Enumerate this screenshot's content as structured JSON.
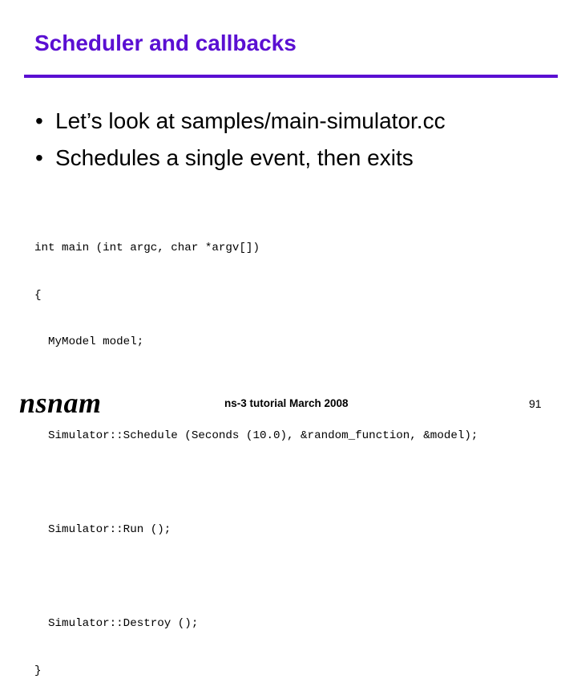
{
  "slide": {
    "title": "Scheduler and callbacks",
    "accent_color": "#5a0fd2",
    "bullets": [
      {
        "marker": "•",
        "text": "Let’s look at samples/main-simulator.cc"
      },
      {
        "marker": "•",
        "text": "Schedules a single event, then exits"
      }
    ],
    "code_lines": [
      "int main (int argc, char *argv[])",
      "{",
      "  MyModel model;",
      "",
      "  Simulator::Schedule (Seconds (10.0), &random_function, &model);",
      "",
      "  Simulator::Run ();",
      "",
      "  Simulator::Destroy ();",
      "}"
    ],
    "footer": {
      "logo": "nsnam",
      "text": "ns-3 tutorial March 2008",
      "page_number": "91"
    }
  }
}
